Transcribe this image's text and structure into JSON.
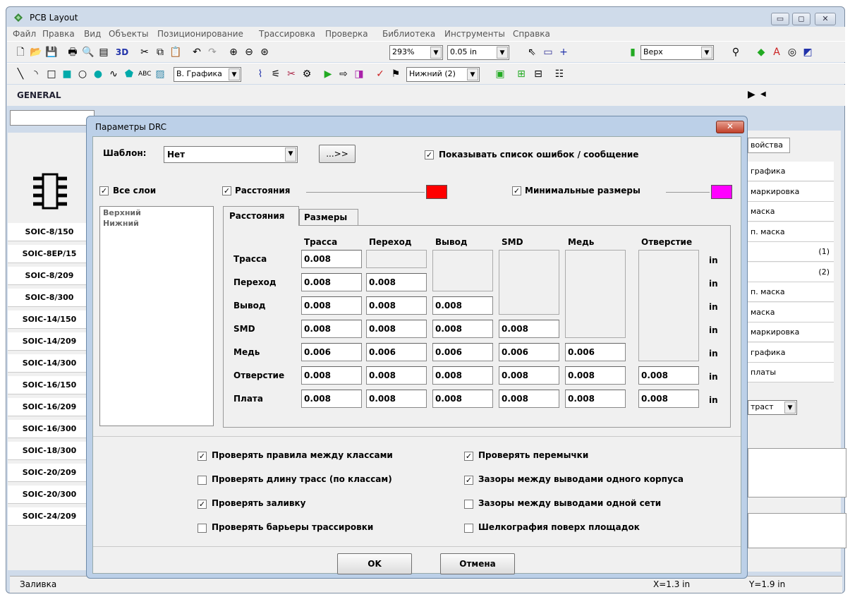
{
  "app": {
    "title": "PCB Layout",
    "minimize": "▭",
    "maximize": "◻",
    "close": "✕"
  },
  "menu": [
    "Файл",
    "Правка",
    "Вид",
    "Объекты",
    "Позиционирование",
    "Трассировка",
    "Проверка",
    "Библиотека",
    "Инструменты",
    "Справка"
  ],
  "toolbar1": {
    "zoom": "293%",
    "grid": "0.05 in",
    "label_3d": "3D",
    "layer": "Верх"
  },
  "toolbar2": {
    "graphics": "В. Графика",
    "layer2": "Нижний (2)",
    "abc": "ABC"
  },
  "toolbar3": {
    "general": "GENERAL"
  },
  "left_panel": {
    "items": [
      "SOIC-8/150",
      "SOIC-8EP/15",
      "SOIC-8/209",
      "SOIC-8/300",
      "SOIC-14/150",
      "SOIC-14/209",
      "SOIC-14/300",
      "SOIC-16/150",
      "SOIC-16/209",
      "SOIC-16/300",
      "SOIC-18/300",
      "SOIC-20/209",
      "SOIC-20/300",
      "SOIC-24/209"
    ]
  },
  "right_panel": {
    "tab": "войства",
    "items": [
      "графика",
      "маркировка",
      "маска",
      "п. маска",
      "(1)",
      "(2)",
      "п. маска",
      "маска",
      "маркировка",
      "графика",
      "платы"
    ],
    "combo": "траст"
  },
  "status": {
    "left": "Заливка",
    "x": "X=1.3 in",
    "y": "Y=1.9 in"
  },
  "dialog": {
    "title": "Параметры DRC",
    "close": "✕",
    "template_label": "Шаблон:",
    "template_value": "Нет",
    "arrow_btn": "...>>",
    "show_errors": "Показывать список ошибок / сообщение",
    "all_layers": "Все слои",
    "layers": [
      "Верхний",
      "Нижний"
    ],
    "clearances": "Расстояния",
    "min_sizes": "Минимальные размеры",
    "clearance_color": "#ff0000",
    "minsize_color": "#ff00ff",
    "tabs": [
      "Расстояния",
      "Размеры"
    ],
    "columns": [
      "Трасса",
      "Переход",
      "Вывод",
      "SMD",
      "Медь",
      "Отверстие"
    ],
    "rows": [
      {
        "label": "Трасса",
        "values": [
          "0.008"
        ]
      },
      {
        "label": "Переход",
        "values": [
          "0.008",
          "0.008"
        ]
      },
      {
        "label": "Вывод",
        "values": [
          "0.008",
          "0.008",
          "0.008"
        ]
      },
      {
        "label": "SMD",
        "values": [
          "0.008",
          "0.008",
          "0.008",
          "0.008"
        ]
      },
      {
        "label": "Медь",
        "values": [
          "0.006",
          "0.006",
          "0.006",
          "0.006",
          "0.006"
        ]
      },
      {
        "label": "Отверстие",
        "values": [
          "0.008",
          "0.008",
          "0.008",
          "0.008",
          "0.008",
          "0.008"
        ]
      },
      {
        "label": "Плата",
        "values": [
          "0.008",
          "0.008",
          "0.008",
          "0.008",
          "0.008",
          "0.008"
        ]
      }
    ],
    "unit": "in",
    "checks_left": [
      {
        "label": "Проверять правила между классами",
        "checked": true
      },
      {
        "label": "Проверять длину трасс (по классам)",
        "checked": false
      },
      {
        "label": "Проверять заливку",
        "checked": true
      },
      {
        "label": "Проверять барьеры трассировки",
        "checked": false
      }
    ],
    "checks_right": [
      {
        "label": "Проверять перемычки",
        "checked": true
      },
      {
        "label": "Зазоры между выводами одного корпуса",
        "checked": true
      },
      {
        "label": "Зазоры между выводами одной сети",
        "checked": false
      },
      {
        "label": "Шелкография поверх площадок",
        "checked": false
      }
    ],
    "ok": "OK",
    "cancel": "Отмена"
  }
}
